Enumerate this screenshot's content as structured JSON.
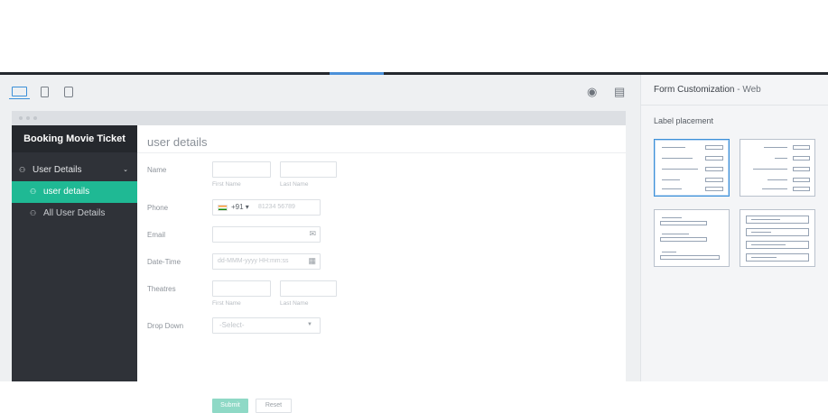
{
  "app": {
    "form_title": "user details",
    "toolbar": {
      "devices": [
        "desktop-icon",
        "tablet-icon",
        "mobile-icon"
      ],
      "tools": [
        "paint-bucket-icon",
        "layout-icon"
      ],
      "active_device": "desktop"
    }
  },
  "sidebar": {
    "title": "Booking Movie Ticket",
    "group_label": "User Details",
    "items": [
      {
        "label": "user details",
        "active": true
      },
      {
        "label": "All User Details",
        "active": false
      }
    ]
  },
  "form": {
    "fields": [
      {
        "label": "Name",
        "sub1": "First Name",
        "sub2": "Last Name"
      },
      {
        "label": "Phone",
        "country_code": "+91 ▾",
        "placeholder": "81234 56789"
      },
      {
        "label": "Email"
      },
      {
        "label": "Date-Time",
        "placeholder": "dd-MMM-yyyy HH:mm:ss"
      },
      {
        "label": "Theatres",
        "sub1": "First Name",
        "sub2": "Last Name"
      },
      {
        "label": "Drop Down",
        "placeholder": "-Select-"
      }
    ],
    "submit_label": "Submit",
    "reset_label": "Reset"
  },
  "panel": {
    "title": "Form Customization",
    "title_suffix": " - Web",
    "section_label": "Label placement",
    "options": [
      "left-aligned",
      "right-aligned",
      "top-stacked",
      "inside-box"
    ],
    "selected": "left-aligned"
  },
  "colors": {
    "accent": "#1fb994",
    "sidebar_bg": "#2f3238",
    "selection": "#3b8fd8"
  }
}
